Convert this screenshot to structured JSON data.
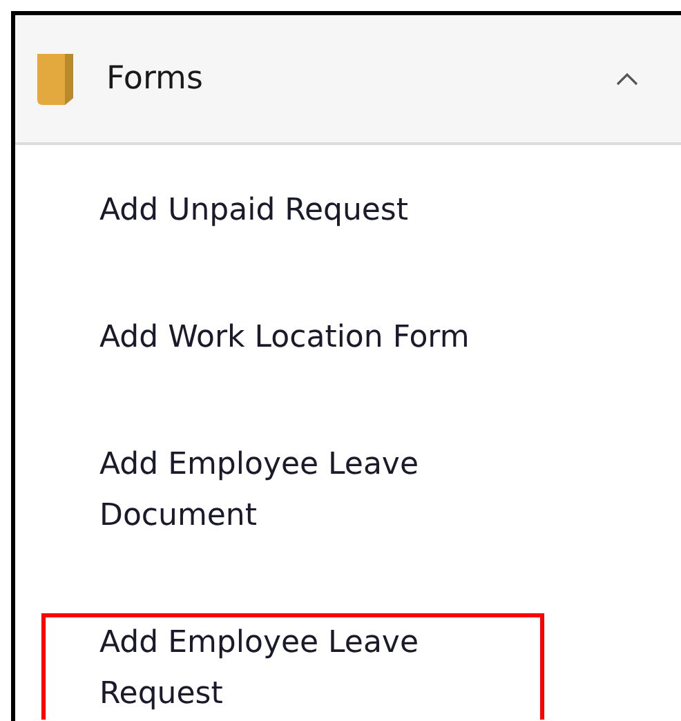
{
  "section": {
    "title": "Forms",
    "expanded": true
  },
  "items": [
    {
      "label": "Add Unpaid Request",
      "highlighted": false
    },
    {
      "label": "Add Work Location Form",
      "highlighted": false
    },
    {
      "label": "Add Employee Leave Document",
      "highlighted": false
    },
    {
      "label": "Add Employee Leave Request",
      "highlighted": true
    }
  ]
}
